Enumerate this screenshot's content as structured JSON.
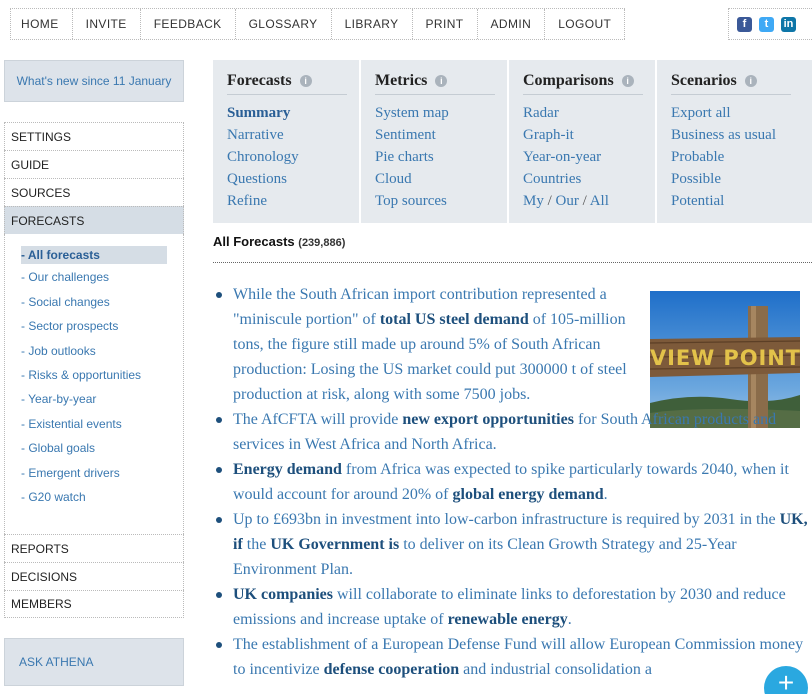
{
  "topnav": [
    "HOME",
    "INVITE",
    "FEEDBACK",
    "GLOSSARY",
    "LIBRARY",
    "PRINT",
    "ADMIN",
    "LOGOUT"
  ],
  "social": {
    "facebook": "f",
    "twitter": "t",
    "linkedin": "in"
  },
  "whatsnew": "What's new since 11 January",
  "sidebar": {
    "top": [
      "SETTINGS",
      "GUIDE",
      "SOURCES",
      "FORECASTS"
    ],
    "sub": [
      "- All forecasts",
      "- Our challenges",
      "- Social changes",
      "- Sector prospects",
      "- Job outlooks",
      "- Risks & opportunities",
      "- Year-by-year",
      "- Existential events",
      "- Global goals",
      "- Emergent drivers",
      "- G20 watch"
    ],
    "bottom": [
      "REPORTS",
      "DECISIONS",
      "MEMBERS"
    ]
  },
  "ask": "ASK ATHENA",
  "menu": {
    "forecasts": {
      "title": "Forecasts",
      "links": [
        "Summary",
        "Narrative",
        "Chronology",
        "Questions",
        "Refine"
      ]
    },
    "metrics": {
      "title": "Metrics",
      "links": [
        "System map",
        "Sentiment",
        "Pie charts",
        "Cloud",
        "Top sources"
      ]
    },
    "comparisons": {
      "title": "Comparisons",
      "links": [
        "Radar",
        "Graph-it",
        "Year-on-year",
        "Countries"
      ],
      "last": [
        "My",
        "Our",
        "All"
      ]
    },
    "scenarios": {
      "title": "Scenarios",
      "links": [
        "Export all",
        "Business as usual",
        "Probable",
        "Possible",
        "Potential"
      ]
    }
  },
  "heading": {
    "title": "All Forecasts",
    "count": "(239,886)"
  },
  "image": {
    "sign_text": "VIEW POINT"
  },
  "items": [
    {
      "a": "While the South African import contribution represented a \"miniscule portion\" of ",
      "b": "total US steel demand",
      "c": " of 105-million tons, the figure still made up around 5% of South African production: Losing the US market could put 300000 t of steel production at risk, along with some 7500 jobs."
    },
    {
      "a": "The AfCFTA will provide ",
      "b": "new export opportunities",
      "c": " for South African products and services in West Africa and North Africa."
    },
    {
      "b1": "Energy demand",
      "m": " from Africa was expected to spike particularly towards 2040, when it would account for around 20% of ",
      "b2": "global energy demand",
      "e": "."
    },
    {
      "a": "Up to £693bn in investment into low-carbon infrastructure is required by 2031 in the ",
      "b1": "UK, if",
      "m": " the ",
      "b2": "UK Government is",
      "e": " to deliver on its Clean Growth Strategy and 25-Year Environment Plan."
    },
    {
      "b1": "UK companies",
      "m": " will collaborate to eliminate links to deforestation by 2030 and reduce emissions and increase uptake of ",
      "b2": "renewable energy",
      "e": "."
    },
    {
      "a": "The establishment of a European Defense Fund will allow European Commission money to incentivize ",
      "b": "defense cooperation",
      "c": " and industrial consolidation a"
    }
  ],
  "fab_icon": "plus-icon"
}
